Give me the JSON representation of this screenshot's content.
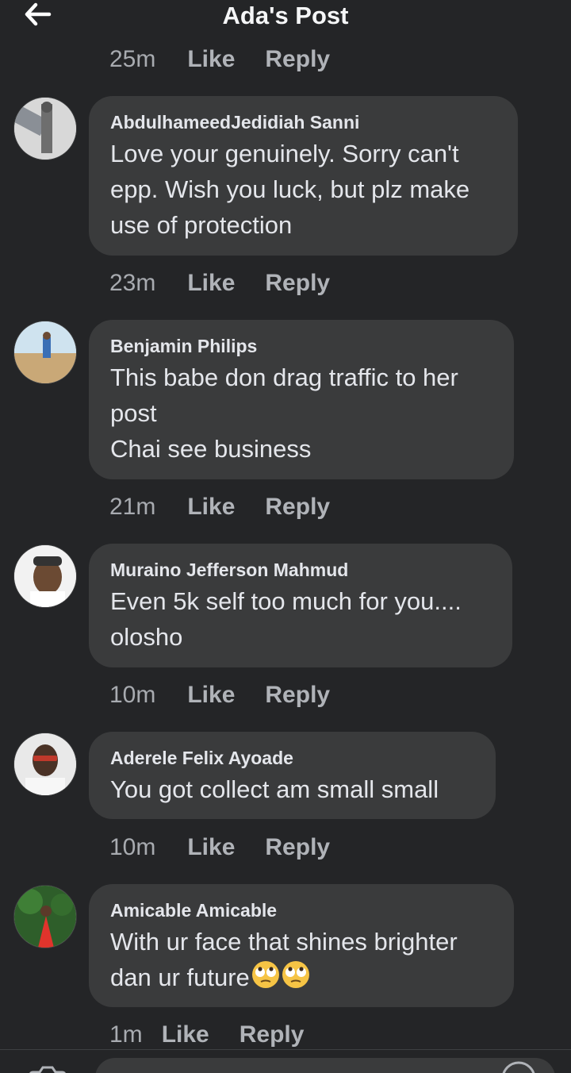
{
  "header": {
    "title": "Ada's Post"
  },
  "top_actions": {
    "time": "25m",
    "like": "Like",
    "reply": "Reply"
  },
  "comments": [
    {
      "name": "AbdulhameedJedidiah Sanni",
      "text": "Love your genuinely. Sorry can't\nepp. Wish you luck, but plz make\nuse of protection",
      "time": "23m",
      "like": "Like",
      "reply": "Reply"
    },
    {
      "name": "Benjamin Philips",
      "text": "This babe don drag traffic to her\npost\nChai see business",
      "time": "21m",
      "like": "Like",
      "reply": "Reply"
    },
    {
      "name": "Muraino Jefferson Mahmud",
      "text": "Even 5k self too much for you....\nolosho",
      "time": "10m",
      "like": "Like",
      "reply": "Reply"
    },
    {
      "name": "Aderele Felix Ayoade",
      "text": "You got collect am small small",
      "time": "10m",
      "like": "Like",
      "reply": "Reply"
    },
    {
      "name": "Amicable Amicable",
      "text": "With ur face that shines brighter\ndan ur future",
      "emoji": "face-with-rolling-eyes",
      "time": "1m",
      "like": "Like",
      "reply": "Reply"
    }
  ],
  "colors": {
    "background": "#242527",
    "bubble": "#3a3b3c",
    "text": "#e4e6eb",
    "muted": "#b0b3b8"
  }
}
